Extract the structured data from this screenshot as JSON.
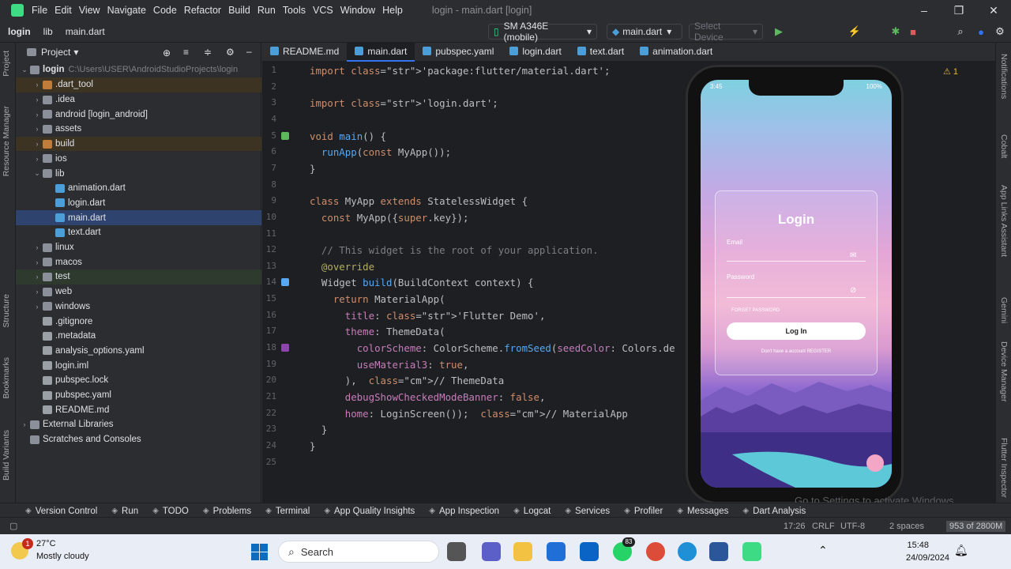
{
  "menubar": {
    "items": [
      "File",
      "Edit",
      "View",
      "Navigate",
      "Code",
      "Refactor",
      "Build",
      "Run",
      "Tools",
      "VCS",
      "Window",
      "Help"
    ],
    "title": "login - main.dart [login]"
  },
  "navbar": {
    "crumbs": [
      "login",
      "lib",
      "main.dart"
    ],
    "device": "SM A346E (mobile)",
    "run_config": "main.dart",
    "select_device": "Select Device"
  },
  "project": {
    "title": "Project",
    "root": "login",
    "root_path": "C:\\Users\\USER\\AndroidStudioProjects\\login",
    "rows": [
      {
        "label": ".dart_tool",
        "depth": 1,
        "arrow": "›",
        "icon": "folder-o",
        "hl": "orange"
      },
      {
        "label": ".idea",
        "depth": 1,
        "arrow": "›",
        "icon": "folder"
      },
      {
        "label": "android [login_android]",
        "depth": 1,
        "arrow": "›",
        "icon": "folder"
      },
      {
        "label": "assets",
        "depth": 1,
        "arrow": "›",
        "icon": "folder"
      },
      {
        "label": "build",
        "depth": 1,
        "arrow": "›",
        "icon": "folder-o",
        "hl": "orange"
      },
      {
        "label": "ios",
        "depth": 1,
        "arrow": "›",
        "icon": "folder"
      },
      {
        "label": "lib",
        "depth": 1,
        "arrow": "⌄",
        "icon": "folder"
      },
      {
        "label": "animation.dart",
        "depth": 2,
        "arrow": "",
        "icon": "file-dart"
      },
      {
        "label": "login.dart",
        "depth": 2,
        "arrow": "",
        "icon": "file-dart"
      },
      {
        "label": "main.dart",
        "depth": 2,
        "arrow": "",
        "icon": "file-dart",
        "hl": "select"
      },
      {
        "label": "text.dart",
        "depth": 2,
        "arrow": "",
        "icon": "file-dart"
      },
      {
        "label": "linux",
        "depth": 1,
        "arrow": "›",
        "icon": "folder"
      },
      {
        "label": "macos",
        "depth": 1,
        "arrow": "›",
        "icon": "folder"
      },
      {
        "label": "test",
        "depth": 1,
        "arrow": "›",
        "icon": "folder",
        "hl": "green"
      },
      {
        "label": "web",
        "depth": 1,
        "arrow": "›",
        "icon": "folder"
      },
      {
        "label": "windows",
        "depth": 1,
        "arrow": "›",
        "icon": "folder"
      },
      {
        "label": ".gitignore",
        "depth": 1,
        "arrow": "",
        "icon": "file-txt"
      },
      {
        "label": ".metadata",
        "depth": 1,
        "arrow": "",
        "icon": "file-txt"
      },
      {
        "label": "analysis_options.yaml",
        "depth": 1,
        "arrow": "",
        "icon": "file-txt"
      },
      {
        "label": "login.iml",
        "depth": 1,
        "arrow": "",
        "icon": "file-txt"
      },
      {
        "label": "pubspec.lock",
        "depth": 1,
        "arrow": "",
        "icon": "file-txt"
      },
      {
        "label": "pubspec.yaml",
        "depth": 1,
        "arrow": "",
        "icon": "file-txt"
      },
      {
        "label": "README.md",
        "depth": 1,
        "arrow": "",
        "icon": "file-txt"
      },
      {
        "label": "External Libraries",
        "depth": 0,
        "arrow": "›",
        "icon": "folder"
      },
      {
        "label": "Scratches and Consoles",
        "depth": 0,
        "arrow": "",
        "icon": "folder"
      }
    ]
  },
  "tabs": [
    "README.md",
    "main.dart",
    "pubspec.yaml",
    "login.dart",
    "text.dart",
    "animation.dart"
  ],
  "active_tab": "main.dart",
  "editor": {
    "warnings": "1",
    "lines": [
      "import 'package:flutter/material.dart';",
      "",
      "import 'login.dart';",
      "",
      "void main() {",
      "  runApp(const MyApp());",
      "}",
      "",
      "class MyApp extends StatelessWidget {",
      "  const MyApp({super.key});",
      "",
      "  // This widget is the root of your application.",
      "  @override",
      "  Widget build(BuildContext context) {",
      "    return MaterialApp(",
      "      title: 'Flutter Demo',",
      "      theme: ThemeData(",
      "        colorScheme: ColorScheme.fromSeed(seedColor: Colors.de",
      "        useMaterial3: true,",
      "      ),  // ThemeData",
      "      debugShowCheckedModeBanner: false,",
      "      home: LoginScreen());  // MaterialApp",
      "  }",
      "}",
      ""
    ]
  },
  "phone": {
    "time": "3:45",
    "battery": "100%",
    "title": "Login",
    "email_label": "Email",
    "password_label": "Password",
    "forget": "FORGET PASSWORD",
    "login_btn": "Log In",
    "register": "Don't have a account REGISTER"
  },
  "left_strip": [
    "Project",
    "Resource Manager",
    "Structure",
    "Bookmarks",
    "Build Variants"
  ],
  "right_strip": [
    "Notifications",
    "Cobalt",
    "App Links Assistant",
    "Gemini",
    "Device Manager",
    "Flutter Inspector"
  ],
  "bottombar": [
    "Version Control",
    "Run",
    "TODO",
    "Problems",
    "Terminal",
    "App Quality Insights",
    "App Inspection",
    "Logcat",
    "Services",
    "Profiler",
    "Messages",
    "Dart Analysis"
  ],
  "statusline": {
    "pos": "17:26",
    "crlf": "CRLF",
    "enc": "UTF-8",
    "indent": "2 spaces",
    "mem": "953 of 2800M"
  },
  "watermark": "Go to Settings to activate Windows.",
  "taskbar": {
    "temp": "27°C",
    "weather": "Mostly cloudy",
    "badge": "1",
    "search": "Search",
    "time": "15:48",
    "date": "24/09/2024",
    "wa_badge": "83"
  }
}
